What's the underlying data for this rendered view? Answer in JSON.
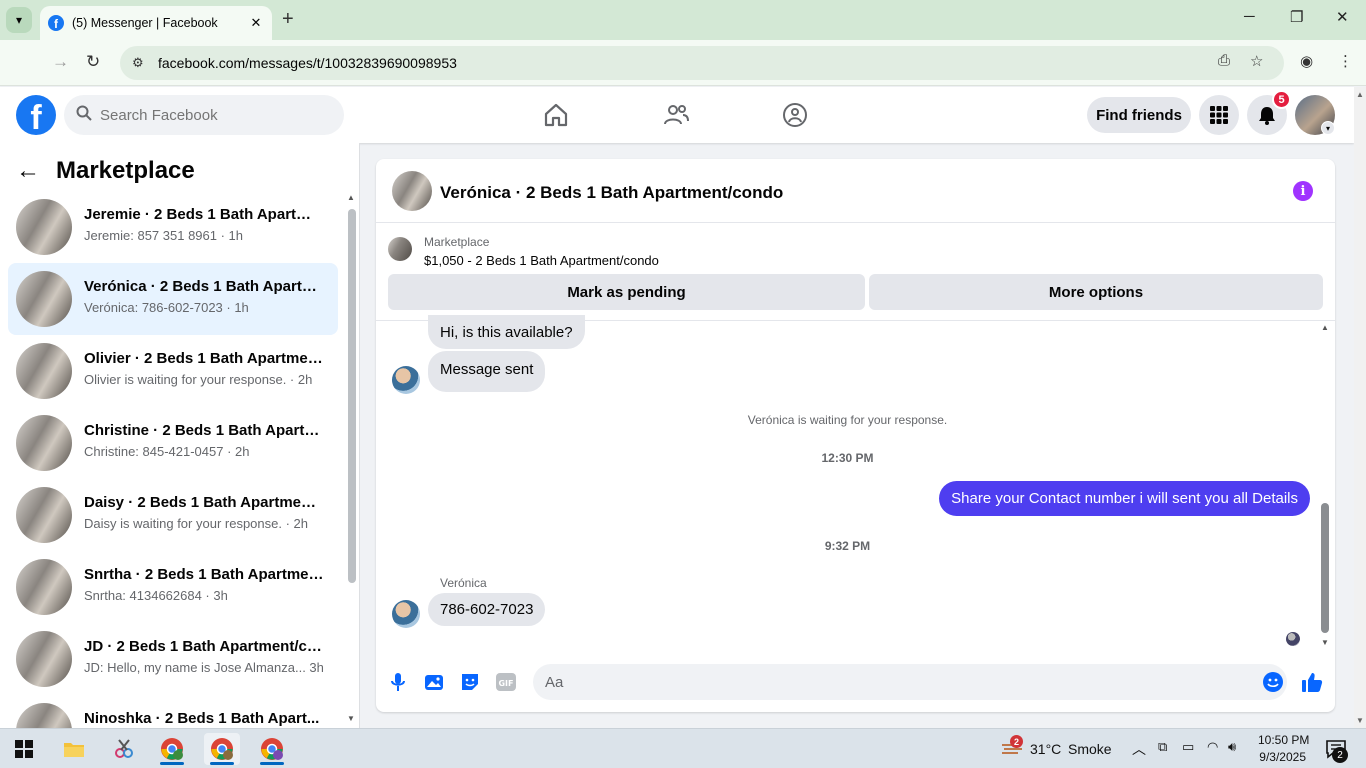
{
  "browser": {
    "tab_title": "(5) Messenger | Facebook",
    "url": "facebook.com/messages/t/10032839690098953"
  },
  "header": {
    "search_placeholder": "Search Facebook",
    "find_friends_label": "Find friends",
    "notification_count": "5"
  },
  "sidebar": {
    "title": "Marketplace",
    "conversations": [
      {
        "name": "Jeremie · 2 Beds 1 Bath Apartme...",
        "preview": "Jeremie: 857 351 8961 · 1h",
        "active": false
      },
      {
        "name": "Verónica · 2 Beds 1 Bath Apartm...",
        "preview": "Verónica: 786-602-7023 · 1h",
        "active": true
      },
      {
        "name": "Olivier · 2 Beds 1 Bath Apartmen...",
        "preview": "Olivier is waiting for your response. · 2h",
        "active": false
      },
      {
        "name": "Christine · 2 Beds 1 Bath Apartm...",
        "preview": "Christine: 845-421-0457 · 2h",
        "active": false
      },
      {
        "name": "Daisy · 2 Beds 1 Bath Apartment...",
        "preview": "Daisy is waiting for your response. · 2h",
        "active": false
      },
      {
        "name": "Snrtha · 2 Beds 1 Bath Apartmen...",
        "preview": "Snrtha: 4134662684 · 3h",
        "active": false
      },
      {
        "name": "JD · 2 Beds 1 Bath Apartment/co...",
        "preview": "JD: Hello, my name is Jose Almanza... 3h",
        "active": false
      },
      {
        "name": "Ninoshka · 2 Beds 1 Bath Apart...",
        "preview": "",
        "active": false
      }
    ]
  },
  "chat": {
    "title": "Verónica · 2 Beds 1 Bath Apartment/condo",
    "marketplace_label": "Marketplace",
    "listing": "$1,050 - 2 Beds 1 Bath Apartment/condo",
    "mark_pending_label": "Mark as pending",
    "more_options_label": "More options",
    "messages": {
      "m1": "Hi, is this available?",
      "m2": "Message sent",
      "system": "Verónica is waiting for your response.",
      "time1": "12:30 PM",
      "out1": "Share your Contact number i will sent you all Details",
      "time2": "9:32 PM",
      "sender": "Verónica",
      "m3": "786-602-7023"
    },
    "composer_placeholder": "Aa"
  },
  "taskbar": {
    "temperature": "31°C",
    "weather": "Smoke",
    "weather_badge": "2",
    "time": "10:50 PM",
    "date": "9/3/2025",
    "notif_count": "2"
  },
  "colors": {
    "fb_blue": "#1877f2",
    "outgoing_bubble": "#4e3ef0",
    "active_row": "#e7f3ff",
    "notification_red": "#e41e3f"
  }
}
